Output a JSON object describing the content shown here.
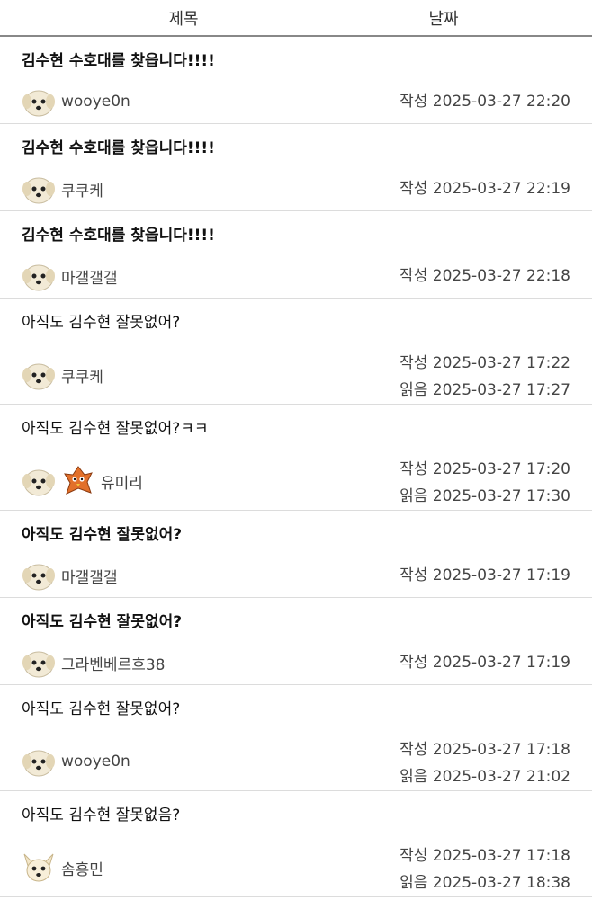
{
  "header": {
    "title_col": "제목",
    "date_col": "날짜"
  },
  "rows": [
    {
      "title": "김수현 수호대를 찾읍니다!!!!",
      "bold": true,
      "author": "wooye0n",
      "avatars": [
        "dog-avatar"
      ],
      "written_label": "작성",
      "written": "2025-03-27 22:20"
    },
    {
      "title": "김수현 수호대를 찾읍니다!!!!",
      "bold": true,
      "author": "쿠쿠케",
      "avatars": [
        "dog-avatar"
      ],
      "written_label": "작성",
      "written": "2025-03-27 22:19"
    },
    {
      "title": "김수현 수호대를 찾읍니다!!!!",
      "bold": true,
      "author": "마갤갤갤",
      "avatars": [
        "dog-avatar"
      ],
      "written_label": "작성",
      "written": "2025-03-27 22:18"
    },
    {
      "title": "아직도 김수현 잘못없어?",
      "bold": false,
      "author": "쿠쿠케",
      "avatars": [
        "dog-avatar"
      ],
      "written_label": "작성",
      "written": "2025-03-27 17:22",
      "read_label": "읽음",
      "read": "2025-03-27 17:27"
    },
    {
      "title": "아직도 김수현 잘못없어?ㅋㅋ",
      "bold": false,
      "author": "유미리",
      "avatars": [
        "dog-avatar",
        "orange-bird-avatar"
      ],
      "written_label": "작성",
      "written": "2025-03-27 17:20",
      "read_label": "읽음",
      "read": "2025-03-27 17:30"
    },
    {
      "title": "아직도 김수현 잘못없어?",
      "bold": true,
      "author": "마갤갤갤",
      "avatars": [
        "dog-avatar"
      ],
      "written_label": "작성",
      "written": "2025-03-27 17:19"
    },
    {
      "title": "아직도 김수현 잘못없어?",
      "bold": true,
      "author": "그라벤베르흐38",
      "avatars": [
        "dog-avatar"
      ],
      "written_label": "작성",
      "written": "2025-03-27 17:19"
    },
    {
      "title": "아직도 김수현 잘못없어?",
      "bold": false,
      "author": "wooye0n",
      "avatars": [
        "dog-avatar"
      ],
      "written_label": "작성",
      "written": "2025-03-27 17:18",
      "read_label": "읽음",
      "read": "2025-03-27 21:02"
    },
    {
      "title": "아직도 김수현 잘못없음?",
      "bold": false,
      "author": "솜흥민",
      "avatars": [
        "chihuahua-avatar"
      ],
      "written_label": "작성",
      "written": "2025-03-27 17:18",
      "read_label": "읽음",
      "read": "2025-03-27 18:38"
    }
  ]
}
